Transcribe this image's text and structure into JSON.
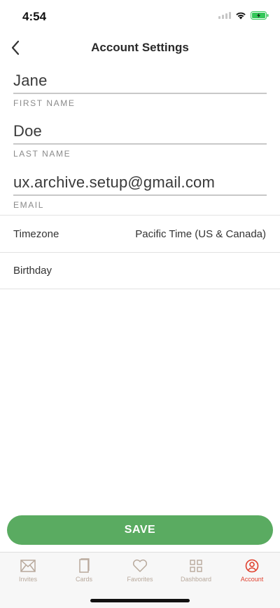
{
  "status": {
    "time": "4:54"
  },
  "nav": {
    "title": "Account Settings",
    "back_icon": "chevron-left-icon"
  },
  "fields": {
    "first_name": {
      "value": "Jane",
      "label": "FIRST NAME"
    },
    "last_name": {
      "value": "Doe",
      "label": "LAST NAME"
    },
    "email": {
      "value": "ux.archive.setup@gmail.com",
      "label": "EMAIL"
    }
  },
  "rows": {
    "timezone": {
      "label": "Timezone",
      "value": "Pacific Time (US & Canada)"
    },
    "birthday": {
      "label": "Birthday",
      "value": ""
    }
  },
  "save_label": "SAVE",
  "tabs": [
    {
      "label": "Invites",
      "icon": "envelope-icon",
      "active": false
    },
    {
      "label": "Cards",
      "icon": "card-icon",
      "active": false
    },
    {
      "label": "Favorites",
      "icon": "heart-icon",
      "active": false
    },
    {
      "label": "Dashboard",
      "icon": "grid-icon",
      "active": false
    },
    {
      "label": "Account",
      "icon": "user-circle-icon",
      "active": true
    }
  ],
  "colors": {
    "accent_green": "#5aab61",
    "active_tab": "#e0412f",
    "inactive_tab": "#b8a99c",
    "battery_green": "#34c759"
  }
}
